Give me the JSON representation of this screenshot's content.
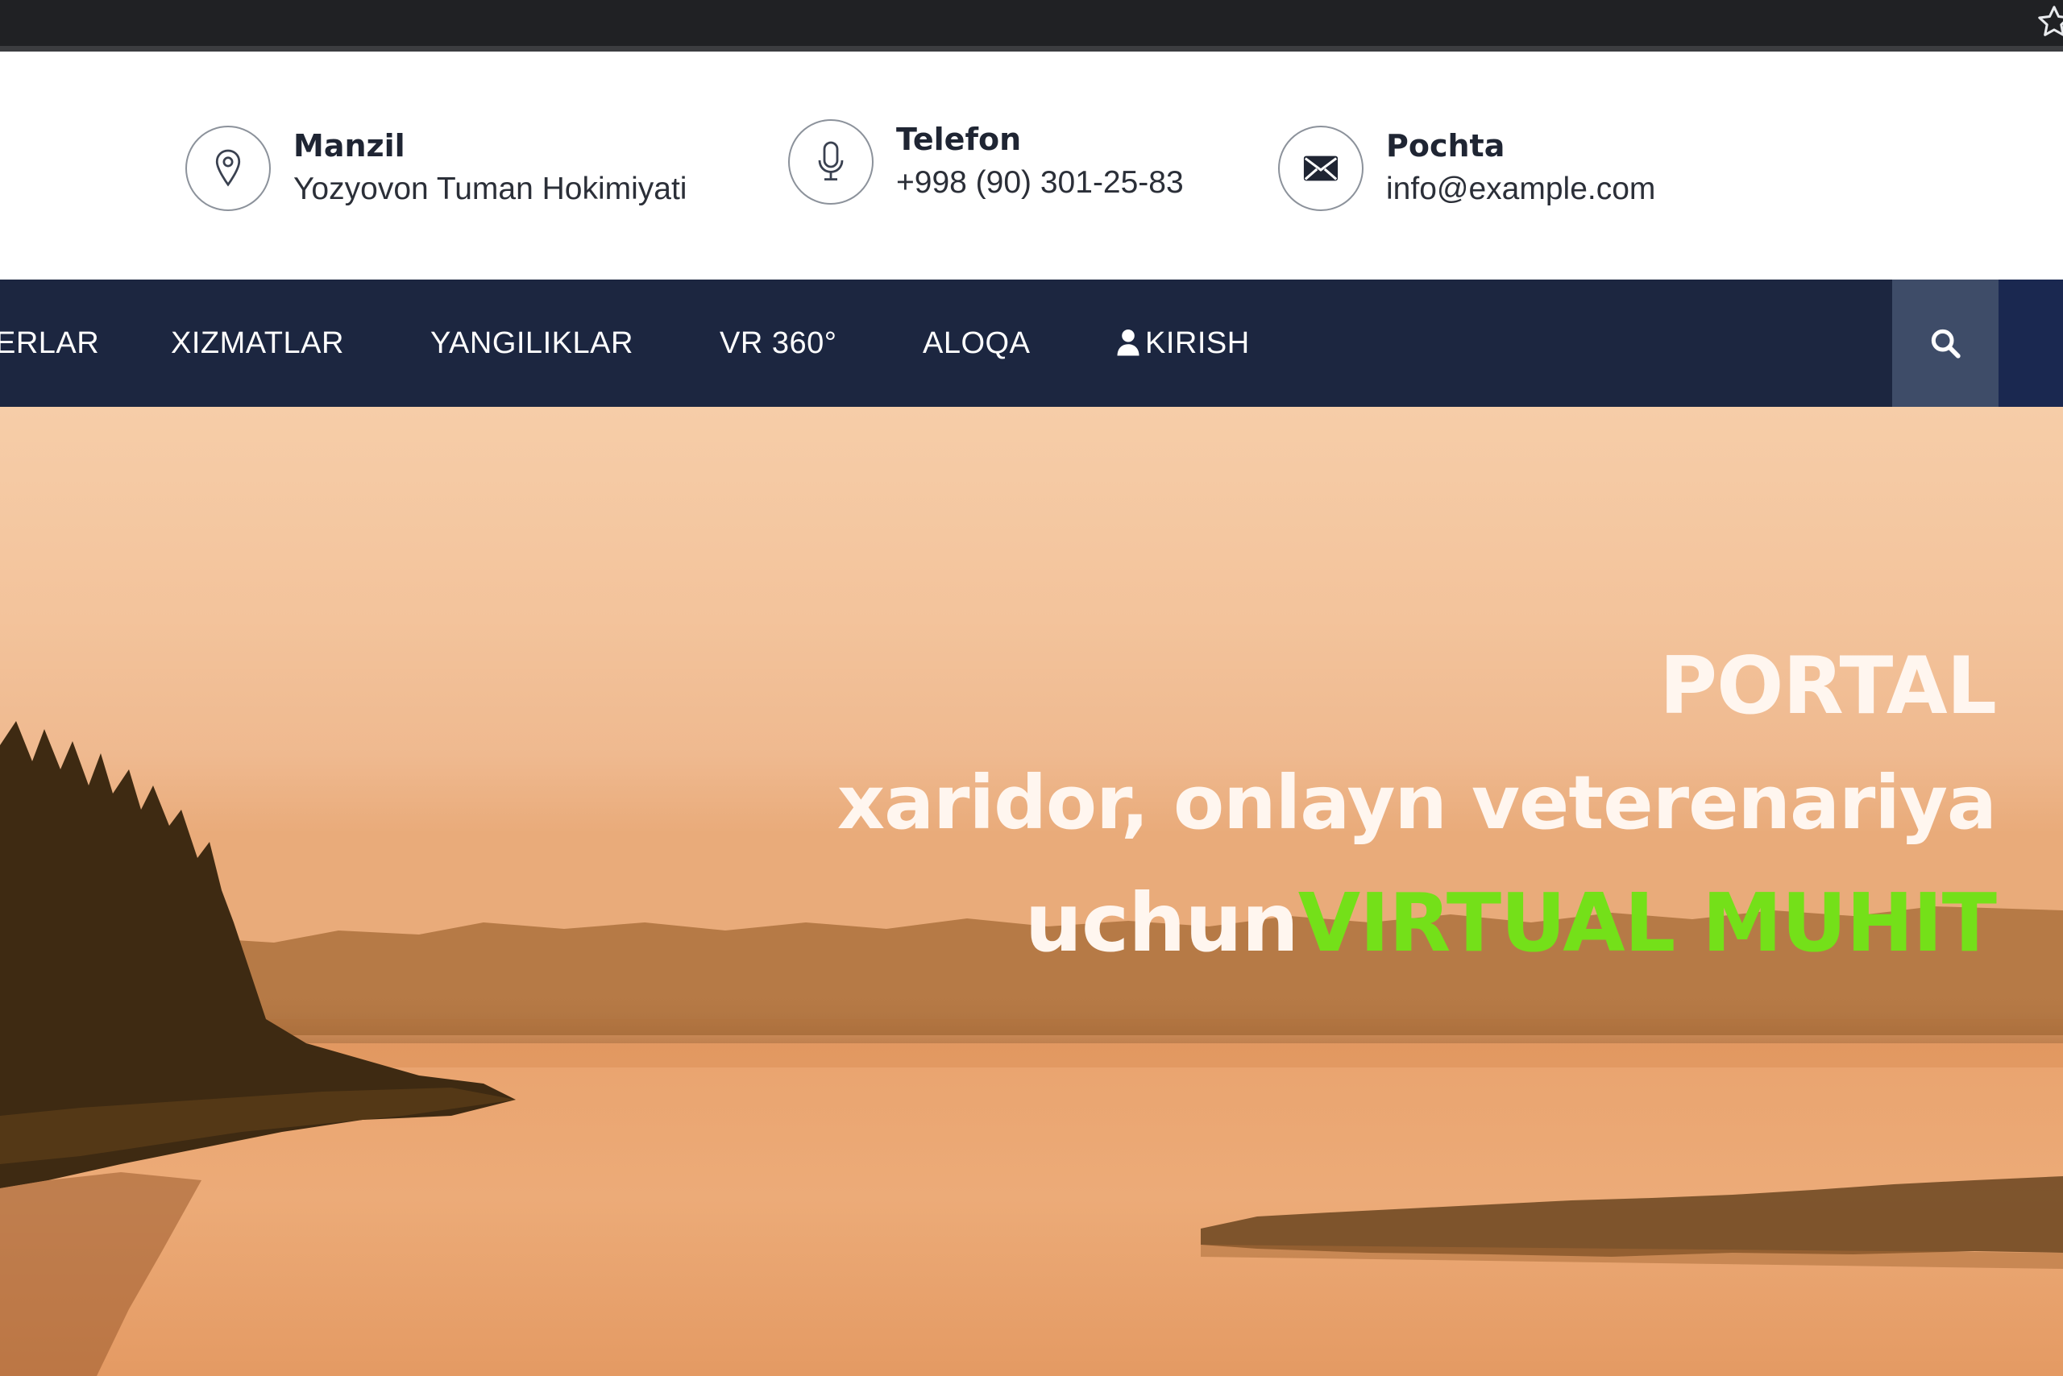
{
  "browser": {
    "star_icon": "star-outline-icon"
  },
  "contact": {
    "address": {
      "title": "Manzil",
      "value": "Yozyovon Tuman Hokimiyati",
      "icon": "location-pin-icon"
    },
    "phone": {
      "title": "Telefon",
      "value": "+998 (90) 301-25-83",
      "icon": "microphone-icon"
    },
    "email": {
      "title": "Pochta",
      "value": "info@example.com",
      "icon": "envelope-icon"
    }
  },
  "nav": {
    "items": [
      {
        "label": "ERLAR"
      },
      {
        "label": "XIZMATLAR"
      },
      {
        "label": "YANGILIKLAR"
      },
      {
        "label": "VR 360°"
      },
      {
        "label": "ALOQA"
      },
      {
        "label": "KIRISH",
        "icon": "user-icon"
      }
    ],
    "search_icon": "search-icon"
  },
  "hero": {
    "line1": "PORTAL",
    "line2": "xaridor, onlayn veterenariya",
    "line3_prefix": "uchun",
    "line3_highlight": "VIRTUAL MUHIT",
    "colors": {
      "text": "#fff6ef",
      "highlight": "#74e019"
    }
  },
  "colors": {
    "nav_background": "#1c2640",
    "search_background": "#3e4c68",
    "chrome_background": "#202124"
  }
}
